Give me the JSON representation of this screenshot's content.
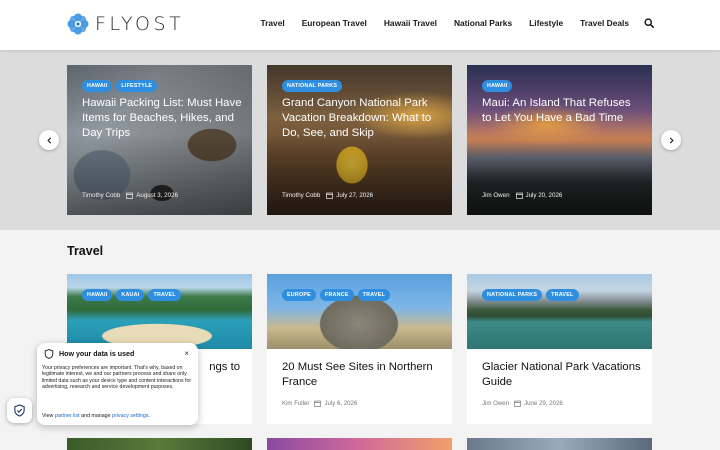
{
  "brand": {
    "name": "FLYOST",
    "accent": "#2f8ee0",
    "logo_color": "#3a8fd6"
  },
  "nav": {
    "items": [
      "Travel",
      "European Travel",
      "Hawaii Travel",
      "National Parks",
      "Lifestyle",
      "Travel Deals"
    ],
    "search_icon": "search-icon"
  },
  "slider": {
    "prev_icon": "chevron-left-icon",
    "next_icon": "chevron-right-icon",
    "slides": [
      {
        "tags": [
          "HAWAII",
          "LIFESTYLE"
        ],
        "title": "Hawaii Packing List: Must Have Items for Beaches, Hikes, and Day Trips",
        "author": "Timothy Cobb",
        "date": "August 3, 2026"
      },
      {
        "tags": [
          "NATIONAL PARKS"
        ],
        "title": "Grand Canyon National Park Vacation Breakdown: What to Do, See, and Skip",
        "author": "Timothy Cobb",
        "date": "July 27, 2026"
      },
      {
        "tags": [
          "HAWAII"
        ],
        "title": "Maui: An Island That Refuses to Let You Have a Bad Time",
        "author": "Jim Owen",
        "date": "July 20, 2026"
      }
    ]
  },
  "section": {
    "title": "Travel",
    "cards": [
      {
        "tags": [
          "HAWAII",
          "KAUAI",
          "TRAVEL"
        ],
        "title": "ngs to",
        "author": "",
        "date": ""
      },
      {
        "tags": [
          "EUROPE",
          "FRANCE",
          "TRAVEL"
        ],
        "title": "20 Must See Sites in Northern France",
        "author": "Kim Fuller",
        "date": "July 6, 2026"
      },
      {
        "tags": [
          "NATIONAL PARKS",
          "TRAVEL"
        ],
        "title": "Glacier National Park Vacations Guide",
        "author": "Jim Owen",
        "date": "June 29, 2026"
      }
    ]
  },
  "privacy": {
    "title": "How your data is used",
    "close": "×",
    "body": "Your privacy preferences are important. That's why, based on legitimate interest, we and our partners process and share only limited data such as your device type and content interactions for advertising, research and service development purposes.",
    "links_prefix": "View",
    "partner_link": "partner list",
    "links_middle": "and manage",
    "settings_link": "privacy settings",
    "links_suffix": "."
  }
}
